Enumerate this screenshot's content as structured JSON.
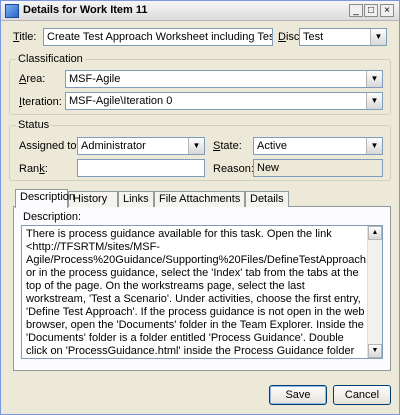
{
  "window": {
    "title": "Details for Work Item 11",
    "minimize": "_",
    "maximize": "□",
    "close": "×"
  },
  "fields": {
    "title_label_key": "T",
    "title_label_rest": "itle:",
    "title_value": "Create Test Approach Worksheet including Test Thr",
    "discipline_label_key": "D",
    "discipline_label_rest": "iscipline:",
    "discipline_value": "Test"
  },
  "classification": {
    "legend": "Classification",
    "area_label_key": "A",
    "area_label_rest": "rea:",
    "area_value": "MSF-Agile",
    "iteration_label_key": "I",
    "iteration_label_rest": "teration:",
    "iteration_value": "MSF-Agile\\Iteration 0"
  },
  "status": {
    "legend": "Status",
    "assigned_label_pre": "Assigned to:",
    "assigned_value": "Administrator",
    "state_label_key": "S",
    "state_label_rest": "tate:",
    "state_value": "Active",
    "rank_label_pre": "Ran",
    "rank_label_key": "k",
    "rank_label_post": ":",
    "rank_value": "",
    "reason_label": "Reason:",
    "reason_value": "New"
  },
  "tabs": [
    {
      "label": "Description"
    },
    {
      "label": "History"
    },
    {
      "label": "Links"
    },
    {
      "label": "File Attachments"
    },
    {
      "label": "Details"
    }
  ],
  "description": {
    "label": "Description:",
    "text": "There is process guidance available for this task. Open the link <http://TFSRTM/sites/MSF-Agile/Process%20Guidance/Supporting%20Files/DefineTestApproach.htm> or in the process guidance, select the 'Index' tab from the tabs at the top of the page. On the workstreams page, select the last workstream, 'Test a Scenario'. Under activities, choose the first entry, 'Define Test Approach'. If the process guidance is not open in the web browser, open the 'Documents' folder in the Team Explorer. Inside the 'Documents' folder is a folder entitled 'Process Guidance'. Double click on 'ProcessGuidance.html' inside the Process Guidance folder to bring up the process guidance."
  },
  "buttons": {
    "save": "Save",
    "cancel": "Cancel"
  },
  "colors": {
    "window_bg": "#ece9d8",
    "field_border": "#7f9db9"
  }
}
